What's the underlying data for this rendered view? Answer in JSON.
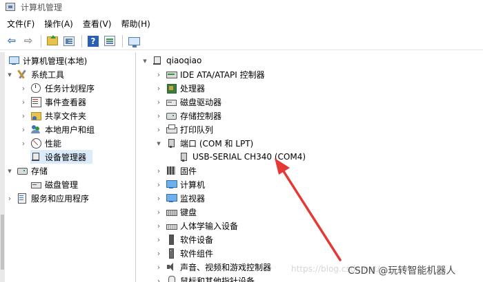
{
  "window": {
    "title": "计算机管理"
  },
  "menu": [
    "文件(F)",
    "操作(A)",
    "查看(V)",
    "帮助(H)"
  ],
  "toolbar": [
    "back-icon",
    "forward-icon",
    "up-folder-icon",
    "show-tree-icon",
    "help-icon",
    "properties-icon",
    "monitor-icon"
  ],
  "left_tree": [
    {
      "label": "计算机管理(本地)",
      "icon": "computer-icon",
      "expander": ""
    },
    {
      "label": "系统工具",
      "icon": "tools-icon",
      "expander": "▾"
    },
    {
      "label": "任务计划程序",
      "icon": "clock-icon",
      "expander": "›"
    },
    {
      "label": "事件查看器",
      "icon": "event-viewer-icon",
      "expander": "›"
    },
    {
      "label": "共享文件夹",
      "icon": "shared-folder-icon",
      "expander": "›"
    },
    {
      "label": "本地用户和组",
      "icon": "users-icon",
      "expander": "›"
    },
    {
      "label": "性能",
      "icon": "performance-icon",
      "expander": "›"
    },
    {
      "label": "设备管理器",
      "icon": "device-manager-icon",
      "expander": "",
      "selected": true
    },
    {
      "label": "存储",
      "icon": "storage-icon",
      "expander": "▾"
    },
    {
      "label": "磁盘管理",
      "icon": "disk-icon",
      "expander": ""
    },
    {
      "label": "服务和应用程序",
      "icon": "services-icon",
      "expander": "›"
    }
  ],
  "right_tree": [
    {
      "label": "qiaoqiao",
      "icon": "computer-icon",
      "expander": "▾"
    },
    {
      "label": "IDE ATA/ATAPI 控制器",
      "icon": "ide-controller-icon",
      "expander": "›"
    },
    {
      "label": "处理器",
      "icon": "processor-icon",
      "expander": "›"
    },
    {
      "label": "磁盘驱动器",
      "icon": "disk-drive-icon",
      "expander": "›"
    },
    {
      "label": "存储控制器",
      "icon": "storage-controller-icon",
      "expander": "›"
    },
    {
      "label": "打印队列",
      "icon": "print-queue-icon",
      "expander": "›"
    },
    {
      "label": "端口 (COM 和 LPT)",
      "icon": "port-icon",
      "expander": "▾"
    },
    {
      "label": "USB-SERIAL CH340 (COM4)",
      "icon": "port-device-icon",
      "expander": ""
    },
    {
      "label": "固件",
      "icon": "firmware-icon",
      "expander": "›"
    },
    {
      "label": "计算机",
      "icon": "computer-category-icon",
      "expander": "›"
    },
    {
      "label": "监视器",
      "icon": "monitor-icon",
      "expander": "›"
    },
    {
      "label": "键盘",
      "icon": "keyboard-icon",
      "expander": "›"
    },
    {
      "label": "人体学输入设备",
      "icon": "hid-icon",
      "expander": "›"
    },
    {
      "label": "软件设备",
      "icon": "software-device-icon",
      "expander": "›"
    },
    {
      "label": "软件组件",
      "icon": "software-component-icon",
      "expander": "›"
    },
    {
      "label": "声音、视频和游戏控制器",
      "icon": "audio-icon",
      "expander": "›"
    },
    {
      "label": "鼠标和其他指针设备",
      "icon": "mouse-icon",
      "expander": "›"
    }
  ],
  "annotation": {
    "color": "#e53935"
  },
  "watermark": {
    "faint": "https://blog.csdn.net/...",
    "main": "CSDN @玩转智能机器人"
  }
}
